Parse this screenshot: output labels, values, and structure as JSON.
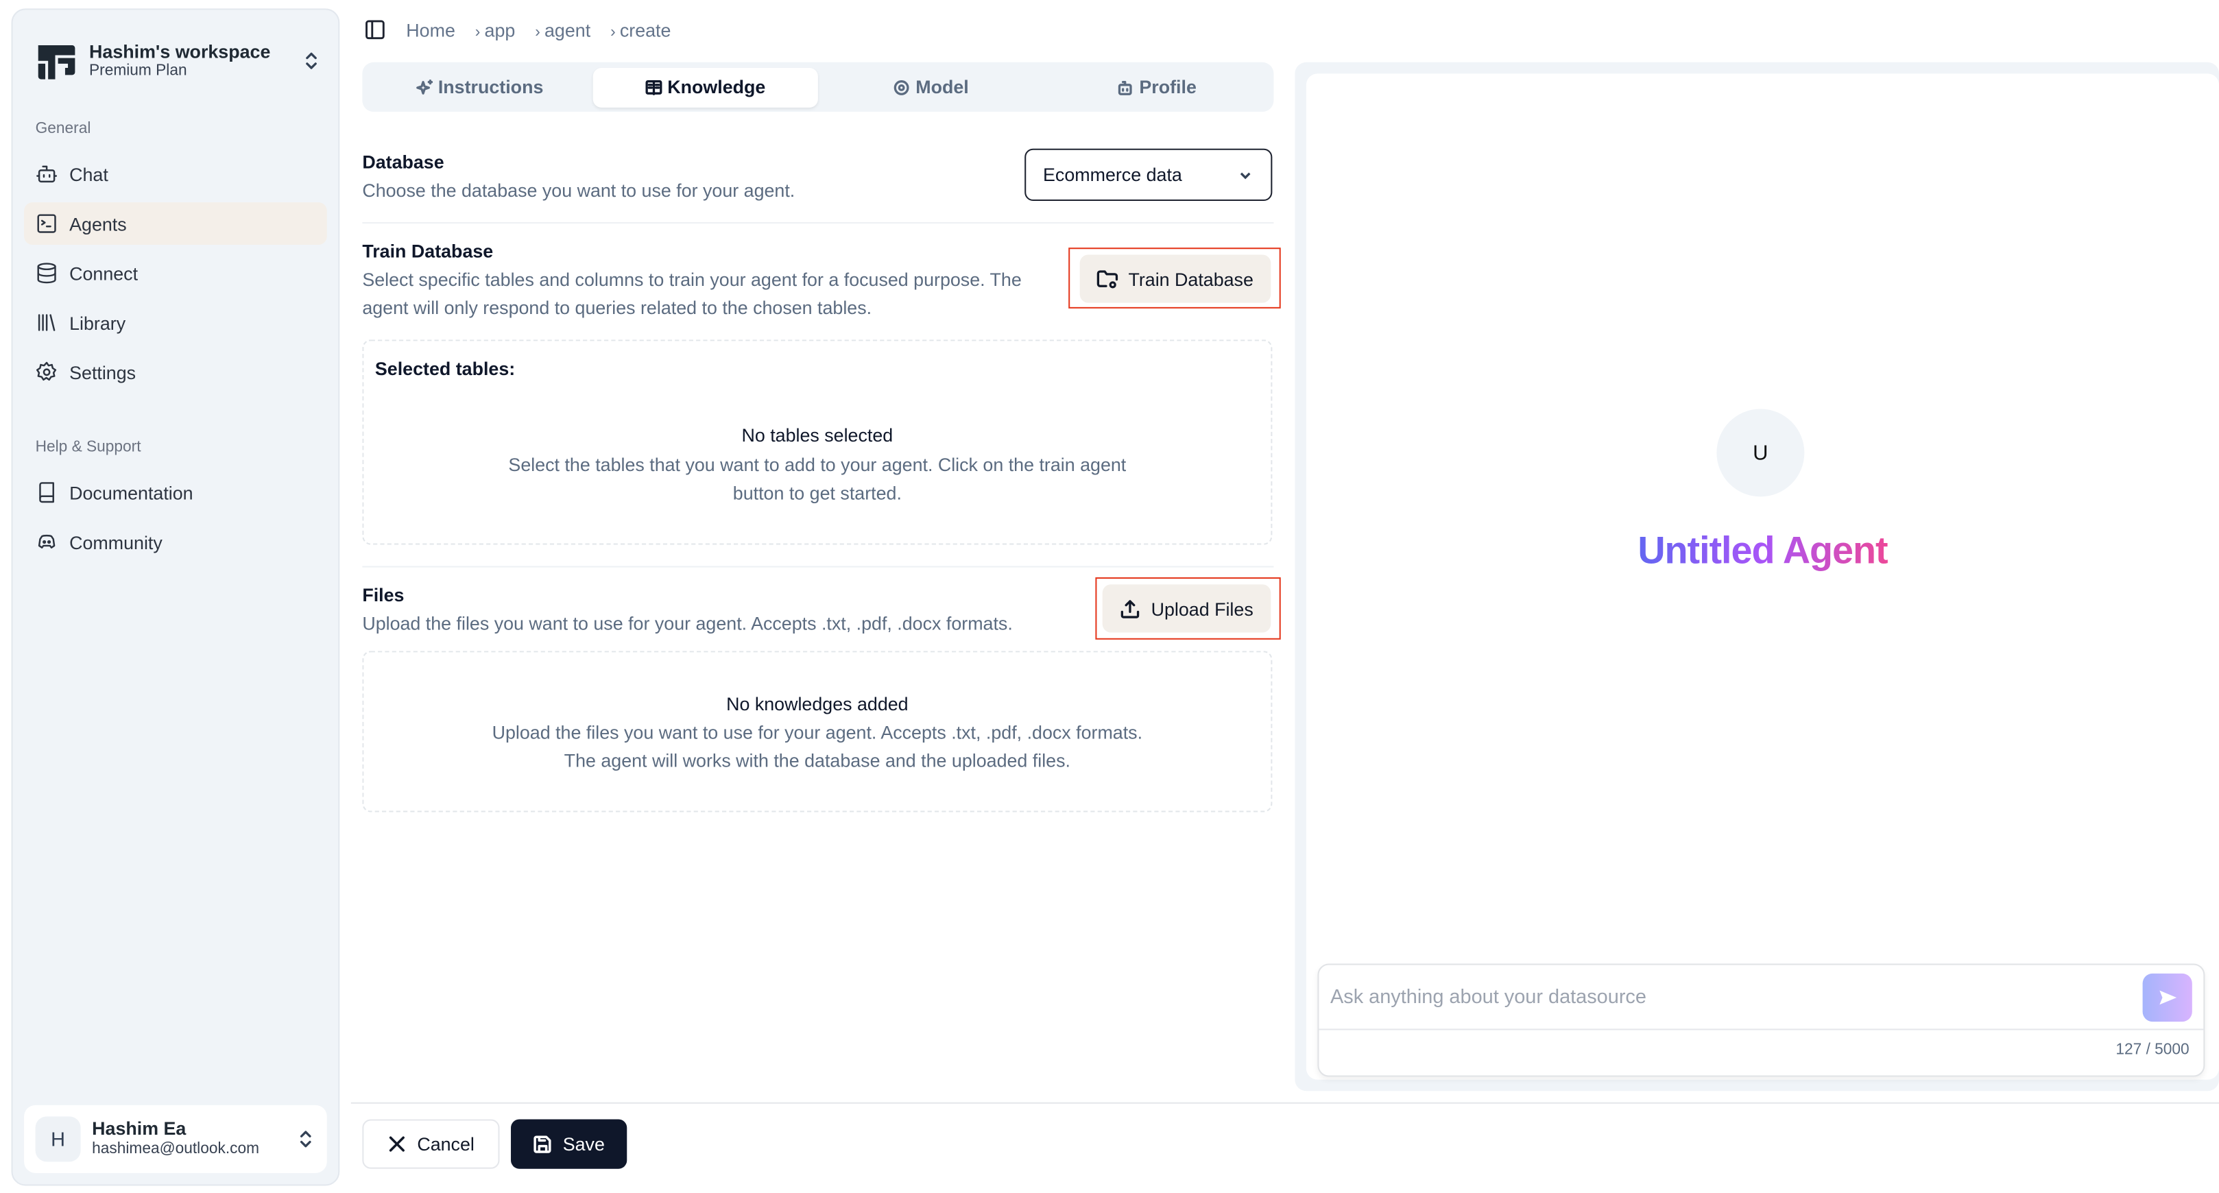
{
  "workspace": {
    "name": "Hashim's workspace",
    "plan": "Premium Plan"
  },
  "sidebar": {
    "general_label": "General",
    "general_items": [
      {
        "label": "Chat",
        "icon": "bot-icon"
      },
      {
        "label": "Agents",
        "icon": "terminal-icon",
        "active": true
      },
      {
        "label": "Connect",
        "icon": "database-icon"
      },
      {
        "label": "Library",
        "icon": "library-icon"
      },
      {
        "label": "Settings",
        "icon": "gear-icon"
      }
    ],
    "help_label": "Help & Support",
    "help_items": [
      {
        "label": "Documentation",
        "icon": "book-icon"
      },
      {
        "label": "Community",
        "icon": "discord-icon"
      }
    ]
  },
  "user": {
    "initial": "H",
    "name": "Hashim Ea",
    "email": "hashimea@outlook.com"
  },
  "breadcrumb": [
    "Home",
    "app",
    "agent",
    "create"
  ],
  "tabs": [
    {
      "label": "Instructions",
      "icon": "sparkles-icon"
    },
    {
      "label": "Knowledge",
      "icon": "book-open-icon",
      "active": true
    },
    {
      "label": "Model",
      "icon": "brain-icon"
    },
    {
      "label": "Profile",
      "icon": "bot-icon"
    }
  ],
  "database": {
    "title": "Database",
    "description": "Choose the database you want to use for your agent.",
    "selected": "Ecommerce data"
  },
  "train": {
    "title": "Train Database",
    "description_line1": "Select specific tables and columns to train your agent for a focused purpose. The",
    "description_line2": "agent will only respond to queries related to the chosen tables.",
    "button_label": "Train Database",
    "selected_label": "Selected tables:",
    "empty_title": "No tables selected",
    "empty_line1": "Select the tables that you want to add to your agent. Click on the train agent",
    "empty_line2": "button to get started."
  },
  "files": {
    "title": "Files",
    "description": "Upload the files you want to use for your agent. Accepts .txt, .pdf, .docx formats.",
    "button_label": "Upload Files",
    "empty_title": "No knowledges added",
    "empty_line1": "Upload the files you want to use for your agent. Accepts .txt, .pdf, .docx formats.",
    "empty_line2": "The agent will works with the database and the uploaded files."
  },
  "footer": {
    "cancel_label": "Cancel",
    "save_label": "Save"
  },
  "preview": {
    "avatar_initial": "U",
    "agent_name": "Untitled Agent",
    "input_placeholder": "Ask anything about your datasource",
    "char_count": "127 / 5000"
  },
  "colors": {
    "highlight": "#e5391e",
    "primary": "#0f172a",
    "active_nav": "#f4efe9",
    "gradient_start": "#6366f1",
    "gradient_end": "#ec4899"
  }
}
